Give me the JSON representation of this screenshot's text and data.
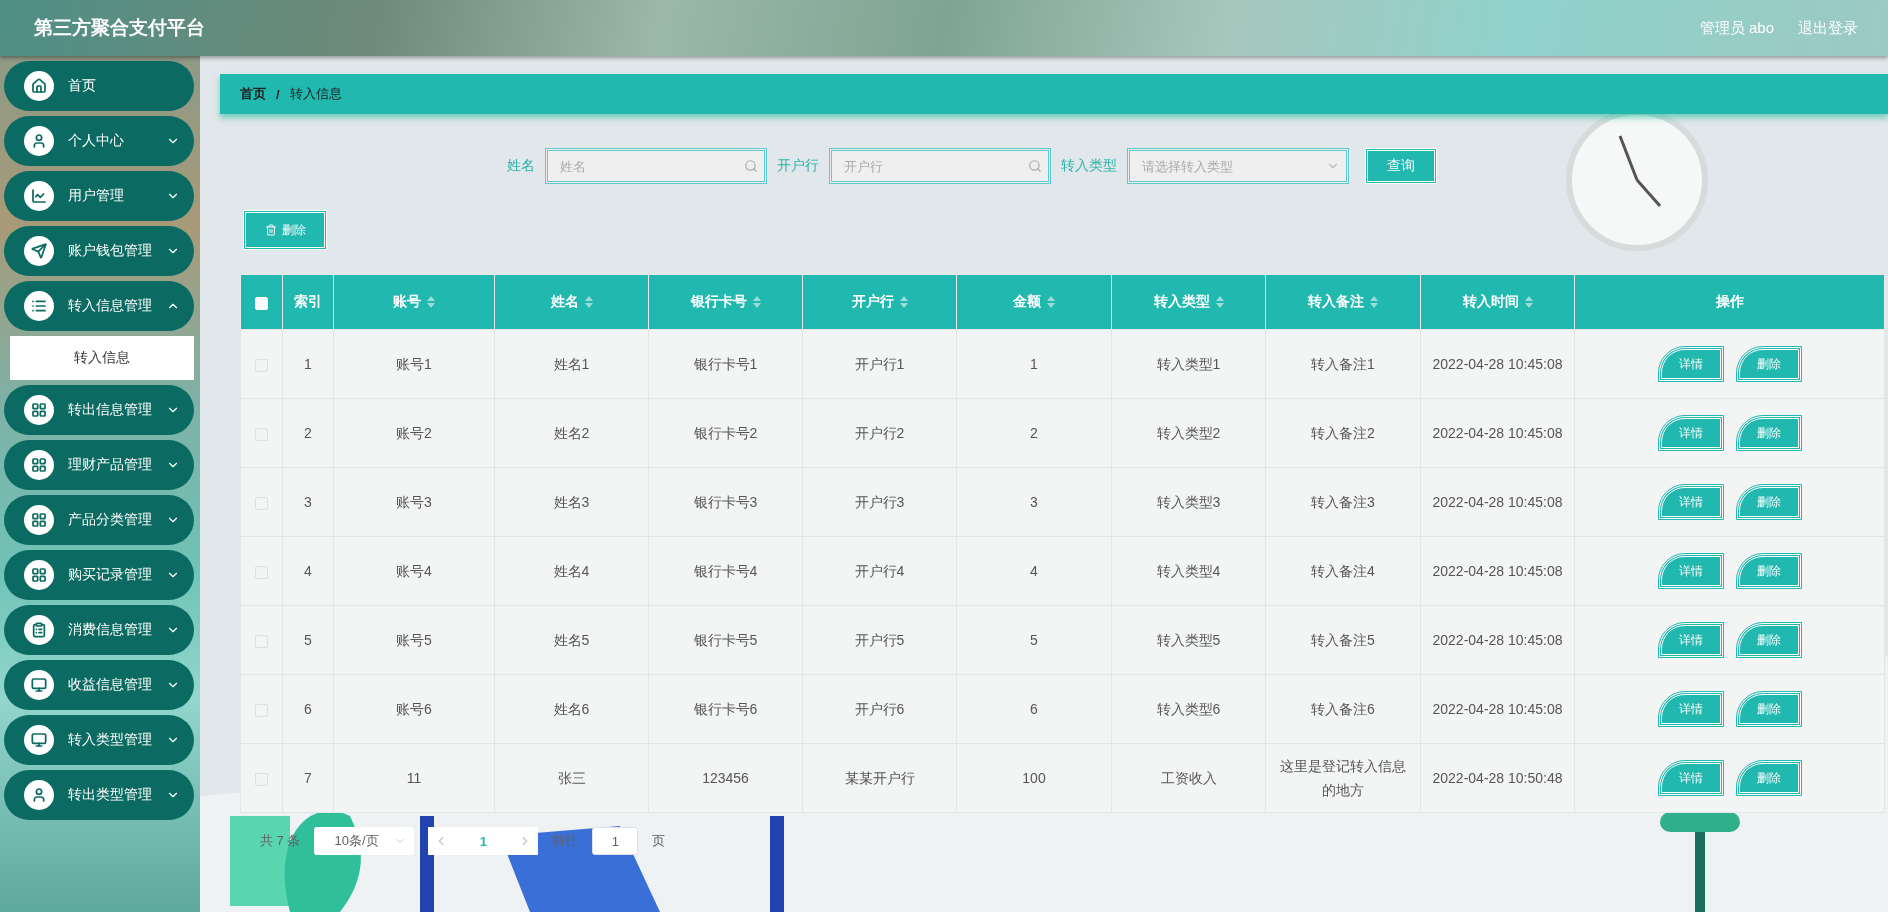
{
  "header": {
    "title": "第三方聚合支付平台",
    "user": "管理员 abo",
    "logout": "退出登录"
  },
  "sidebar": {
    "items": [
      {
        "label": "首页",
        "kind": "link"
      },
      {
        "label": "个人中心",
        "kind": "menu",
        "expanded": false
      },
      {
        "label": "用户管理",
        "kind": "menu",
        "expanded": false
      },
      {
        "label": "账户钱包管理",
        "kind": "menu",
        "expanded": false
      },
      {
        "label": "转入信息管理",
        "kind": "menu",
        "expanded": true,
        "children": [
          {
            "label": "转入信息",
            "selected": true
          }
        ]
      },
      {
        "label": "转出信息管理",
        "kind": "menu",
        "expanded": false
      },
      {
        "label": "理财产品管理",
        "kind": "menu",
        "expanded": false
      },
      {
        "label": "产品分类管理",
        "kind": "menu",
        "expanded": false
      },
      {
        "label": "购买记录管理",
        "kind": "menu",
        "expanded": false
      },
      {
        "label": "消费信息管理",
        "kind": "menu",
        "expanded": false
      },
      {
        "label": "收益信息管理",
        "kind": "menu",
        "expanded": false
      },
      {
        "label": "转入类型管理",
        "kind": "menu",
        "expanded": false
      },
      {
        "label": "转出类型管理",
        "kind": "menu",
        "expanded": false
      }
    ]
  },
  "breadcrumb": {
    "items": [
      "首页",
      "转入信息"
    ],
    "separator": "/"
  },
  "search": {
    "fields": [
      {
        "label": "姓名",
        "placeholder": "姓名",
        "kind": "text"
      },
      {
        "label": "开户行",
        "placeholder": "开户行",
        "kind": "text"
      },
      {
        "label": "转入类型",
        "placeholder": "请选择转入类型",
        "kind": "select"
      }
    ],
    "button": "查询"
  },
  "toolbar": {
    "delete_button": "删除"
  },
  "table": {
    "select_all": {
      "checked": false
    },
    "columns": [
      {
        "label": "索引",
        "sortable": false
      },
      {
        "label": "账号",
        "sortable": true
      },
      {
        "label": "姓名",
        "sortable": true
      },
      {
        "label": "银行卡号",
        "sortable": true
      },
      {
        "label": "开户行",
        "sortable": true
      },
      {
        "label": "金额",
        "sortable": true
      },
      {
        "label": "转入类型",
        "sortable": true
      },
      {
        "label": "转入备注",
        "sortable": true
      },
      {
        "label": "转入时间",
        "sortable": true
      },
      {
        "label": "操作",
        "sortable": false
      }
    ],
    "rows": [
      {
        "checked": false,
        "cells": [
          "1",
          "账号1",
          "姓名1",
          "银行卡号1",
          "开户行1",
          "1",
          "转入类型1",
          "转入备注1",
          "2022-04-28 10:45:08"
        ],
        "actions": [
          "详情",
          "删除"
        ]
      },
      {
        "checked": false,
        "cells": [
          "2",
          "账号2",
          "姓名2",
          "银行卡号2",
          "开户行2",
          "2",
          "转入类型2",
          "转入备注2",
          "2022-04-28 10:45:08"
        ],
        "actions": [
          "详情",
          "删除"
        ]
      },
      {
        "checked": false,
        "cells": [
          "3",
          "账号3",
          "姓名3",
          "银行卡号3",
          "开户行3",
          "3",
          "转入类型3",
          "转入备注3",
          "2022-04-28 10:45:08"
        ],
        "actions": [
          "详情",
          "删除"
        ]
      },
      {
        "checked": false,
        "cells": [
          "4",
          "账号4",
          "姓名4",
          "银行卡号4",
          "开户行4",
          "4",
          "转入类型4",
          "转入备注4",
          "2022-04-28 10:45:08"
        ],
        "actions": [
          "详情",
          "删除"
        ]
      },
      {
        "checked": false,
        "cells": [
          "5",
          "账号5",
          "姓名5",
          "银行卡号5",
          "开户行5",
          "5",
          "转入类型5",
          "转入备注5",
          "2022-04-28 10:45:08"
        ],
        "actions": [
          "详情",
          "删除"
        ]
      },
      {
        "checked": false,
        "cells": [
          "6",
          "账号6",
          "姓名6",
          "银行卡号6",
          "开户行6",
          "6",
          "转入类型6",
          "转入备注6",
          "2022-04-28 10:45:08"
        ],
        "actions": [
          "详情",
          "删除"
        ]
      },
      {
        "checked": false,
        "cells": [
          "7",
          "11",
          "张三",
          "123456",
          "某某开户行",
          "100",
          "工资收入",
          "这里是登记转入信息的地方",
          "2022-04-28 10:50:48"
        ],
        "actions": [
          "详情",
          "删除"
        ]
      }
    ]
  },
  "pagination": {
    "total": "共 7 条",
    "page_size": "10条/页",
    "pages": [
      {
        "label": "1",
        "selected": true
      }
    ],
    "goto_label": "前往",
    "goto_value": "1",
    "goto_suffix": "页"
  }
}
